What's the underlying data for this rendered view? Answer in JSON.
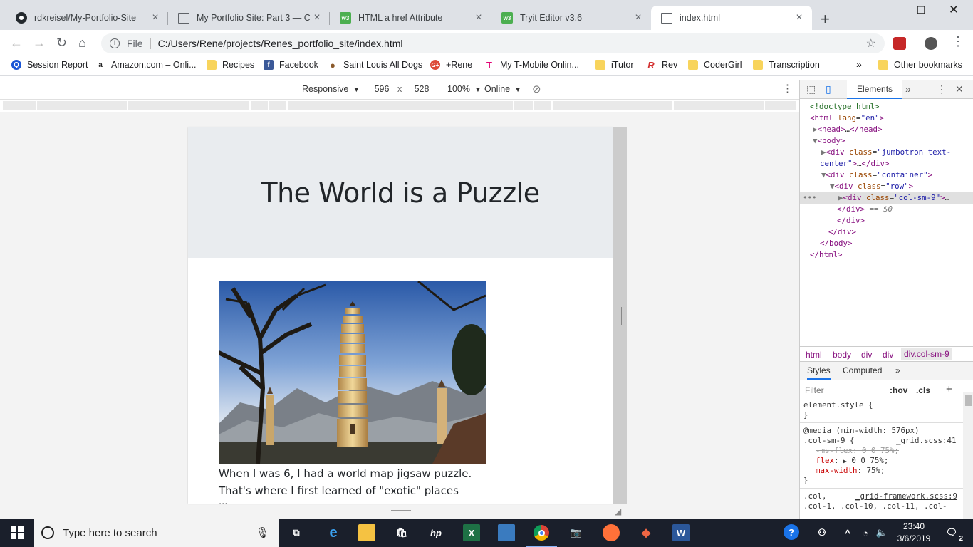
{
  "browser": {
    "tabs": [
      {
        "title": "rdkreisel/My-Portfolio-Site",
        "icon": "github-icon"
      },
      {
        "title": "My Portfolio Site: Part 3 — Co",
        "icon": "page-icon"
      },
      {
        "title": "HTML a href Attribute",
        "icon": "w3schools-icon"
      },
      {
        "title": "Tryit Editor v3.6",
        "icon": "w3schools-icon"
      },
      {
        "title": "index.html",
        "icon": "page-icon",
        "active": true
      }
    ],
    "file_label": "File",
    "url": "C:/Users/Rene/projects/Renes_portfolio_site/index.html",
    "bookmarks": [
      {
        "label": "Session Report",
        "icon": "session-icon",
        "color": "#1a56d6"
      },
      {
        "label": "Amazon.com – Onli...",
        "icon": "amazon-icon",
        "color": "#222222"
      },
      {
        "label": "Recipes",
        "icon": "folder-icon"
      },
      {
        "label": "Facebook",
        "icon": "facebook-icon",
        "color": "#3b5998"
      },
      {
        "label": "Saint Louis All Dogs",
        "icon": "paw-icon",
        "color": "#8b5a2b"
      },
      {
        "label": "+Rene",
        "icon": "google-plus-icon",
        "color": "#dd4b39"
      },
      {
        "label": "My T-Mobile Onlin...",
        "icon": "tmobile-icon",
        "color": "#e20074"
      },
      {
        "label": "iTutor",
        "icon": "folder-icon"
      },
      {
        "label": "Rev",
        "icon": "rev-icon",
        "color": "#d32f2f"
      },
      {
        "label": "CoderGirl",
        "icon": "folder-icon"
      },
      {
        "label": "Transcription",
        "icon": "folder-icon"
      }
    ],
    "more_bookmarks": "»",
    "other_bookmarks": "Other bookmarks"
  },
  "device_toolbar": {
    "mode": "Responsive",
    "width": "596",
    "times": "x",
    "height": "528",
    "zoom": "100%",
    "network": "Online"
  },
  "page": {
    "title": "The World is a Puzzle",
    "body_lines": [
      "When I was 6, I had a world map jigsaw puzzle.",
      "That's where I first learned of \"exotic\" places like"
    ]
  },
  "devtools": {
    "tab": "Elements",
    "more": "»",
    "dom_doctype": "<!doctype html>",
    "dom_eq": "== $0",
    "crumbs": [
      "html",
      "body",
      "div",
      "div",
      "div.col-sm-9"
    ],
    "style_tabs": [
      "Styles",
      "Computed"
    ],
    "filter_placeholder": "Filter",
    "hov": ":hov",
    "cls": ".cls",
    "styles": {
      "element_style": "element.style {",
      "close": "}",
      "media": "@media (min-width: 576px)",
      "selector": ".col-sm-9 {",
      "source": "_grid.scss:41",
      "ms_flex": "-ms-flex: 0 0 75%;",
      "flex_name": "flex",
      "flex_value": "0 0 75%;",
      "maxw_name": "max-width",
      "maxw_value": "75%;",
      "col_selector": ".col,",
      "col_source": "_grid-framework.scss:9",
      "col_list": ".col-1, .col-10, .col-11, .col-"
    }
  },
  "taskbar": {
    "search_placeholder": "Type here to search",
    "time": "23:40",
    "date": "3/6/2019",
    "notifications": "2"
  }
}
